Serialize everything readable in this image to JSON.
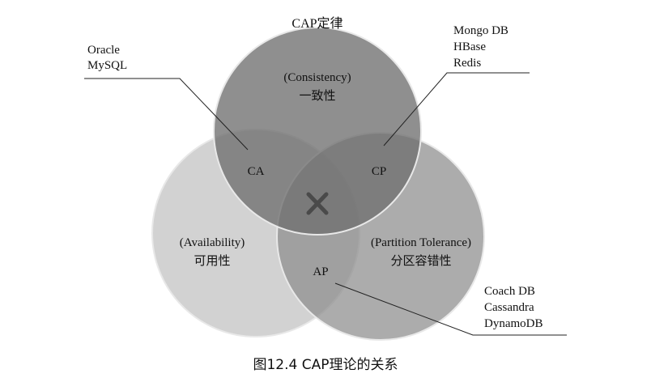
{
  "diagram": {
    "title": "CAP定律",
    "consistency": {
      "en": "(Consistency)",
      "zh": "一致性"
    },
    "availability": {
      "en": "(Availability)",
      "zh": "可用性"
    },
    "partition": {
      "en": "(Partition Tolerance)",
      "zh": "分区容错性"
    },
    "intersections": {
      "ca": "CA",
      "cp": "CP",
      "ap": "AP",
      "center_icon": "x-icon"
    },
    "examples": {
      "ca": [
        "Oracle",
        "MySQL"
      ],
      "cp": [
        "Mongo DB",
        "HBase",
        "Redis"
      ],
      "ap": [
        "Coach DB",
        "Cassandra",
        "DynamoDB"
      ]
    },
    "colors": {
      "consistency": "#8a8a8a",
      "availability": "#d0d0d0",
      "partition": "#9a9a9a",
      "outline": "#e8e8e8"
    }
  },
  "caption": "图12.4 CAP理论的关系"
}
